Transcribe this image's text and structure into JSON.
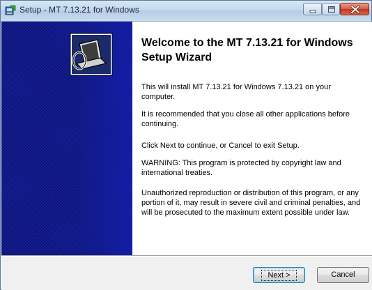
{
  "window": {
    "title": "Setup - MT 7.13.21 for Windows",
    "app_icon": "setup-installer-icon"
  },
  "caption_buttons": {
    "minimize_icon": "minimize-icon",
    "maximize_icon": "maximize-icon",
    "close_icon": "close-icon"
  },
  "sidebar": {
    "logo_icon": "installer-computer-logo-icon",
    "color": "#1620a0"
  },
  "main": {
    "heading": "Welcome to the MT 7.13.21 for Windows Setup Wizard",
    "paragraphs": [
      "This will install MT 7.13.21 for Windows 7.13.21 on your computer.",
      "It is recommended that you close all other applications before continuing.",
      "Click Next to continue, or Cancel to exit Setup.",
      "WARNING: This program is protected by copyright law and international treaties.",
      "Unauthorized reproduction or distribution of this program, or any portion of it, may result in severe civil and criminal penalties, and will be prosecuted to the maximum extent possible under law."
    ]
  },
  "footer": {
    "next_label": "Next >",
    "cancel_label": "Cancel"
  },
  "colors": {
    "titlebar": "#c4d8ec",
    "close_button": "#c0391f",
    "footer": "#f0f0f0"
  }
}
